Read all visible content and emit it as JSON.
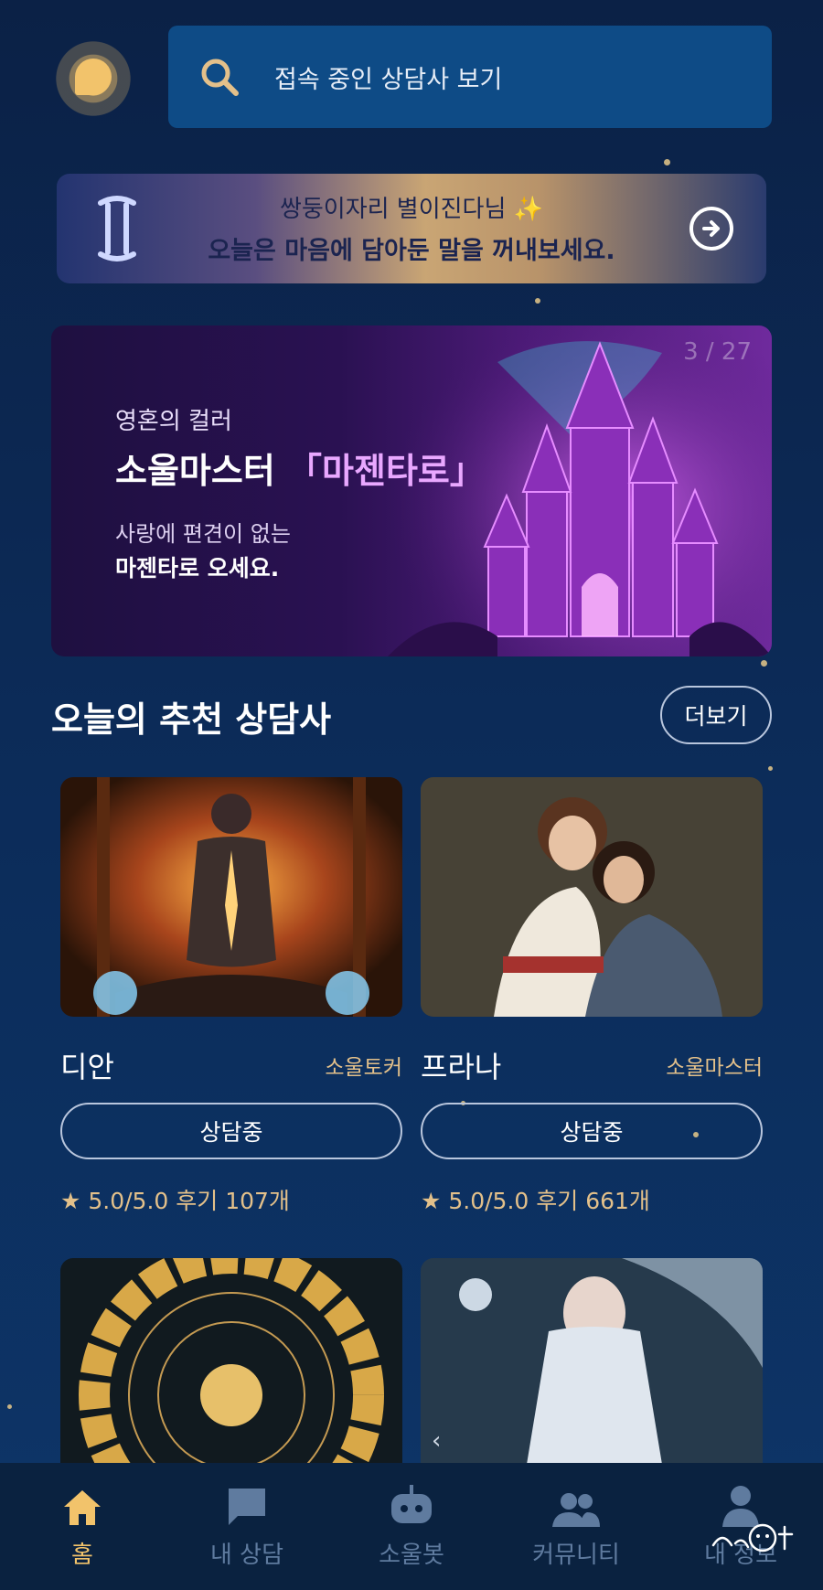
{
  "header": {
    "search_placeholder": "접속 중인 상담사 보기"
  },
  "greeting": {
    "line1": "쌍둥이자리 별이진다님 ✨",
    "line2": "오늘은 마음에 담아둔 말을 꺼내보세요."
  },
  "hero": {
    "pager": "3 / 27",
    "subtitle": "영혼의 컬러",
    "title_prefix": "소울마스터",
    "title_highlight": "「마젠타로」",
    "desc1": "사랑에 편견이 없는",
    "desc2": "마젠타로 오세요."
  },
  "recommend": {
    "title": "오늘의 추천 상담사",
    "more": "더보기",
    "cards": [
      {
        "name": "디안",
        "level": "소울토커",
        "status": "상담중",
        "rating": "★ 5.0/5.0  후기 107개"
      },
      {
        "name": "프라나",
        "level": "소울마스터",
        "status": "상담중",
        "rating": "★ 5.0/5.0  후기 661개"
      }
    ]
  },
  "nav": {
    "items": [
      {
        "label": "홈",
        "icon": "home-icon"
      },
      {
        "label": "내 상담",
        "icon": "chat-icon"
      },
      {
        "label": "소울봇",
        "icon": "robot-icon"
      },
      {
        "label": "커뮤니티",
        "icon": "people-icon"
      },
      {
        "label": "내 정보",
        "icon": "person-icon"
      }
    ]
  },
  "colors": {
    "accent": "#f2c36b",
    "background": "#0c2b58",
    "nav_inactive": "#5f7b9f"
  }
}
